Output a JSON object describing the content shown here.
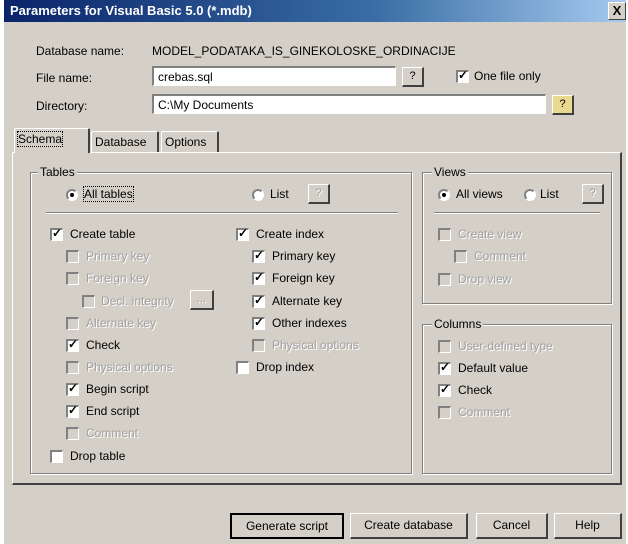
{
  "window": {
    "title": "Parameters for Visual Basic 5.0 (*.mdb)",
    "close_glyph": "X"
  },
  "header": {
    "database_label": "Database name:",
    "database_value": "MODEL_PODATAKA_IS_GINEKOLOSKE_ORDINACIJE",
    "file_label": "File name:",
    "file_value": "crebas.sql",
    "one_file_label": "One file only",
    "one_file_checked": true,
    "directory_label": "Directory:",
    "directory_value": "C:\\My Documents",
    "browse_glyph": "?"
  },
  "tabs": [
    {
      "label": "Schema",
      "active": true
    },
    {
      "label": "Database",
      "active": false
    },
    {
      "label": "Options",
      "active": false
    }
  ],
  "tables": {
    "group_label": "Tables",
    "all_tables": "All tables",
    "list": "List",
    "list_btn": "?",
    "create_table": "Create table",
    "primary_key": "Primary key",
    "foreign_key": "Foreign key",
    "decl_integrity": "Decl. integrity",
    "decl_btn": "...",
    "alternate_key": "Alternate key",
    "check": "Check",
    "physical_options": "Physical options",
    "begin_script": "Begin script",
    "end_script": "End script",
    "comment": "Comment",
    "drop_table": "Drop table",
    "create_index": "Create index",
    "idx_primary_key": "Primary key",
    "idx_foreign_key": "Foreign key",
    "idx_alternate_key": "Alternate key",
    "idx_other_indexes": "Other indexes",
    "idx_physical_options": "Physical options",
    "drop_index": "Drop index"
  },
  "views": {
    "group_label": "Views",
    "all_views": "All views",
    "list": "List",
    "list_btn": "?",
    "create_view": "Create view",
    "comment": "Comment",
    "drop_view": "Drop view"
  },
  "columns": {
    "group_label": "Columns",
    "user_defined_type": "User-defined type",
    "default_value": "Default value",
    "check": "Check",
    "comment": "Comment"
  },
  "footer": {
    "generate": "Generate script",
    "create_db": "Create database",
    "cancel": "Cancel",
    "help": "Help"
  },
  "check_glyph": "✓"
}
